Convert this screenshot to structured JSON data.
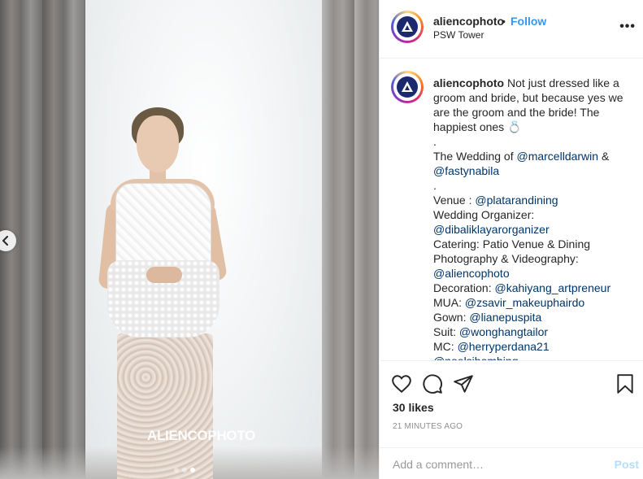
{
  "post": {
    "username": "aliencophoto",
    "separator": "•",
    "follow_label": "Follow",
    "location": "PSW Tower",
    "more_label": "•••",
    "watermark": "ALIENCOPHOTO",
    "carousel": {
      "count": 3,
      "active_index": 2
    }
  },
  "caption": {
    "username": "aliencophoto",
    "intro": "Not just dressed like a groom and bride, but because yes we are the groom and the bride! The happiest ones 💍",
    "dot1": ".",
    "wedding_prefix": "The Wedding of ",
    "wedding_mention1": "@marcelldarwin",
    "wedding_amp": " &",
    "wedding_mention2": "@fastynabila",
    "dot2": ".",
    "venue_label": "Venue : ",
    "venue_mention": "@platarandining",
    "wo_label": "Wedding Organizer:",
    "wo_mention": "@dibaliklayarorganizer",
    "catering": "Catering: Patio Venue & Dining",
    "photo_label": "Photography & Videography:",
    "photo_mention": "@aliencophoto",
    "decor_label": "Decoration: ",
    "decor_mention": "@kahiyang_artpreneur",
    "mua_label": "MUA: ",
    "mua_mention": "@zsavir_makeuphairdo",
    "gown_label": "Gown: ",
    "gown_mention": "@lianepuspita",
    "suit_label": "Suit: ",
    "suit_mention": "@wonghangtailor",
    "mc_label": "MC: ",
    "mc_mention": "@herryperdana21",
    "cutoff_mention": "@noelsihombing"
  },
  "actions": {
    "icons": [
      "heart-icon",
      "comment-icon",
      "share-icon",
      "bookmark-icon"
    ],
    "likes": "30 likes",
    "time_ago": "21 MINUTES AGO"
  },
  "comment_box": {
    "placeholder": "Add a comment…",
    "post_label": "Post"
  },
  "colors": {
    "link": "#3897f0",
    "mention": "#003569",
    "post_disabled": "#b2dffc",
    "muted": "#8e8e8e"
  }
}
